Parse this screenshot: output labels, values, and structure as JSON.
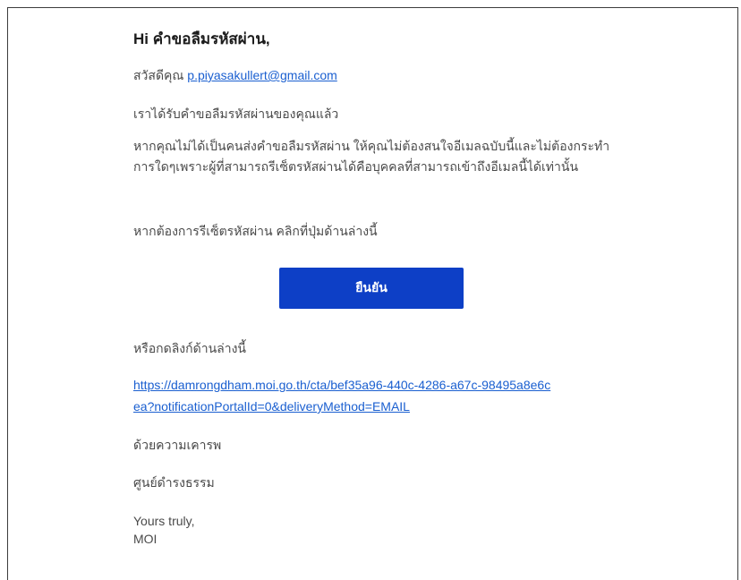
{
  "email": {
    "greeting": "Hi คำขอลืมรหัสผ่าน,",
    "hello_prefix": "สวัสดีคุณ",
    "recipient_email": "p.piyasakullert@gmail.com",
    "received_text": "เราได้รับคำขอลืมรหัสผ่านของคุณแล้ว",
    "ignore_text": "หากคุณไม่ได้เป็นคนส่งคำขอลืมรหัสผ่าน ให้คุณไม่ต้องสนใจอีเมลฉบับนี้และไม่ต้องกระทำการใดๆเพราะผู้ที่สามารถรีเซ็ตรหัสผ่านได้คือบุคคลที่สามารถเข้าถึงอีเมลนี้ได้เท่านั้น",
    "reset_hint": "หากต้องการรีเซ็ตรหัสผ่าน คลิกที่ปุ่มด้านล่างนี้",
    "confirm_button_label": "ยืนยัน",
    "or_link_text": "หรือกดลิงก์ด้านล่างนี้",
    "reset_link": "https://damrongdham.moi.go.th/cta/bef35a96-440c-4286-a67c-98495a8e6cea?notificationPortalId=0&deliveryMethod=EMAIL",
    "regards": "ด้วยความเคารพ",
    "organization": "ศูนย์ดำรงธรรม",
    "signoff_line1": "Yours truly,",
    "signoff_line2": "MOI"
  },
  "colors": {
    "button_bg": "#0d3fc6",
    "link": "#1a5fd0",
    "body_text": "#4a4a4a"
  }
}
